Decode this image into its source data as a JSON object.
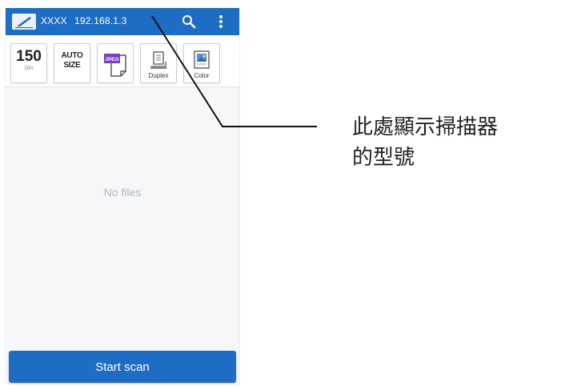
{
  "appbar": {
    "device_name": "XXXX",
    "device_ip": "192.168.1.3",
    "color": "#1f6cc4"
  },
  "toolbar": {
    "resolution": {
      "value": "150",
      "unit": "DPI"
    },
    "paper_size": {
      "line1": "AUTO",
      "line2": "SIZE"
    },
    "format": {
      "icon": "jpeg-file-icon",
      "badge": "JPEG"
    },
    "duplex": {
      "label": "Duplex",
      "icon": "duplex-icon"
    },
    "color_mode": {
      "label": "Color",
      "icon": "color-image-icon"
    }
  },
  "main": {
    "empty_text": "No files"
  },
  "footer": {
    "start_scan_label": "Start scan"
  },
  "annotation": {
    "line1": "此處顯示掃描器",
    "line2": "的型號"
  }
}
